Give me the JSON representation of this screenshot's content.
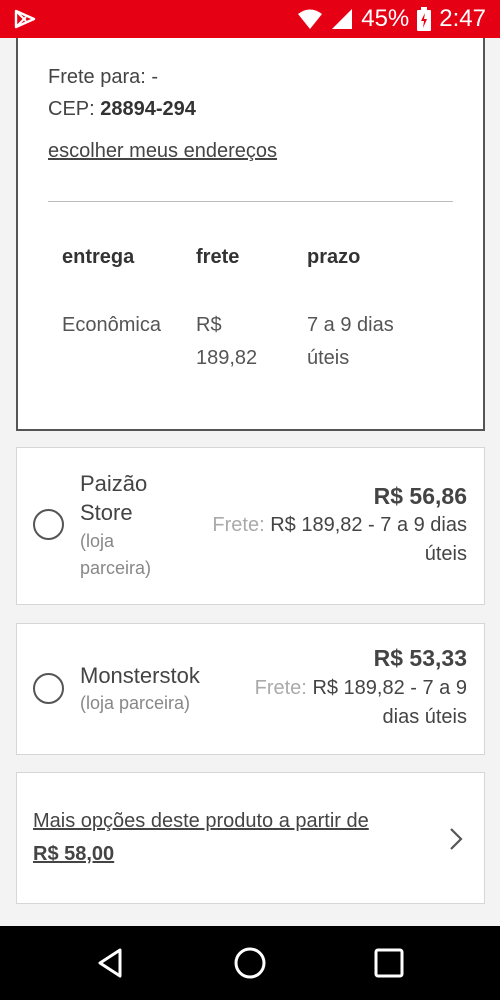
{
  "status_bar": {
    "battery": "45%",
    "time": "2:47",
    "icons": [
      "play-store-icon",
      "wifi-icon",
      "signal-icon",
      "battery-charging-icon"
    ]
  },
  "shipping": {
    "frete_para": "Frete para: -",
    "cep_label": "CEP:",
    "cep_value": "28894-294",
    "choose_address_link": "escolher meus endereços",
    "table": {
      "headers": [
        "entrega",
        "frete",
        "prazo"
      ],
      "row": {
        "entrega": "Econômica",
        "frete_line1": "R$",
        "frete_line2": "189,82",
        "prazo_line1": "7 a 9 dias",
        "prazo_line2": "úteis"
      }
    }
  },
  "offers": [
    {
      "seller_line1": "Paizão",
      "seller_line2": "Store",
      "sub_line1": "(loja",
      "sub_line2": "parceira)",
      "price": "R$ 56,86",
      "ship_label": "Frete:",
      "ship_line1_value": "R$ 189,82 - 7 a 9 dias",
      "ship_line2": "úteis"
    },
    {
      "seller_line1": "Monsterstok",
      "sub_line1": "(loja parceira)",
      "price": "R$ 53,33",
      "ship_label": "Frete:",
      "ship_line1_value": "R$ 189,82 - 7 a 9",
      "ship_line2": "dias úteis"
    }
  ],
  "more_options": {
    "text": "Mais opções deste produto a partir de",
    "price": "R$ 58,00"
  },
  "colors": {
    "brand_red": "#e60014",
    "nav_black": "#000000"
  }
}
